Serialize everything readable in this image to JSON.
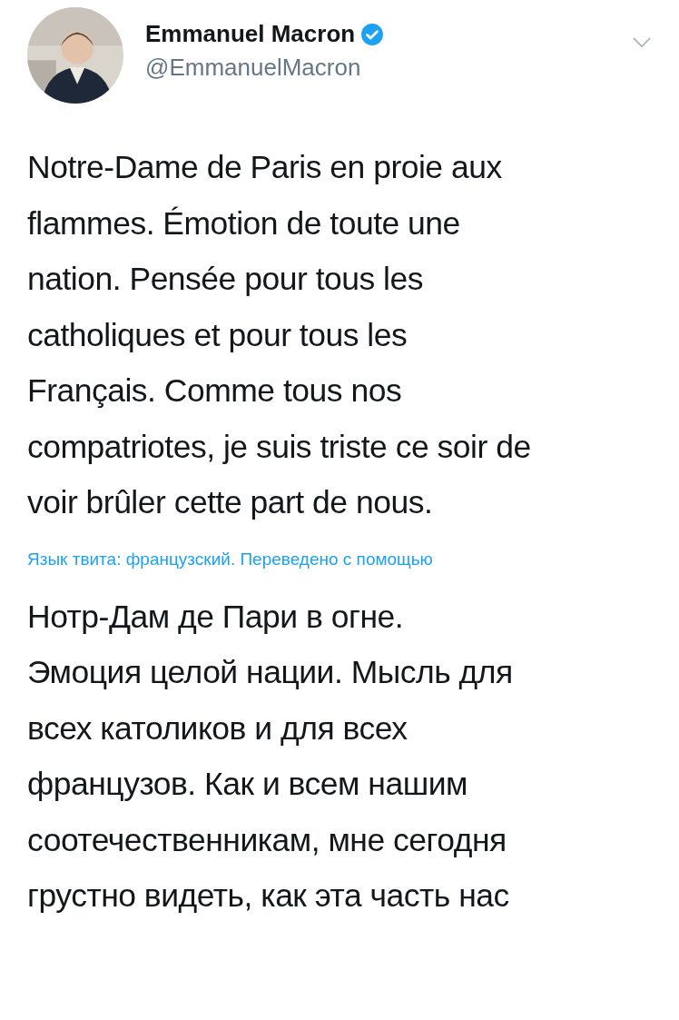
{
  "tweet": {
    "author": {
      "name": "Emmanuel Macron",
      "handle": "@EmmanuelMacron",
      "verified": true
    },
    "text": "Notre-Dame de Paris en proie aux\nflammes. Émotion de toute une\nnation. Pensée pour tous les\ncatholiques et pour tous les\nFrançais. Comme tous nos\ncompatriotes, je suis triste ce soir de\nvoir brûler cette part de nous.",
    "translation_note": "Язык твита: французский. Переведено с помощью",
    "translation": "Нотр-Дам де Пари в огне.\nЭмоция целой нации. Мысль для\nвсех католиков и для всех\nфранцузов. Как и всем нашим\nсоотечественникам, мне сегодня\nгрустно видеть, как эта часть нас"
  }
}
